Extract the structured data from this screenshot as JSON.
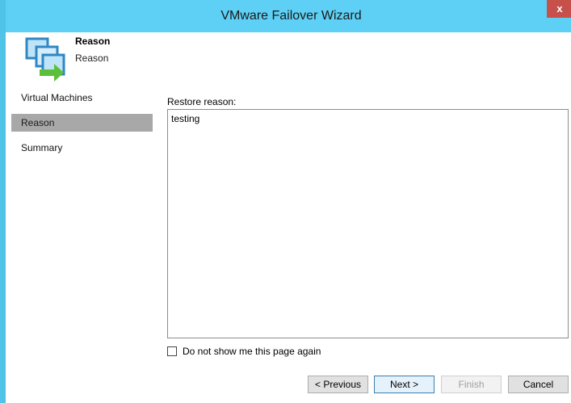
{
  "window": {
    "title": "VMware Failover Wizard",
    "close_label": "x"
  },
  "header": {
    "title": "Reason",
    "subtitle": "Reason",
    "icon": "vm-failover-icon"
  },
  "nav": {
    "items": [
      {
        "label": "Virtual Machines",
        "active": false
      },
      {
        "label": "Reason",
        "active": true
      },
      {
        "label": "Summary",
        "active": false
      }
    ]
  },
  "form": {
    "label": "Restore reason:",
    "value": "testing",
    "checkbox_label": "Do not show me this page again",
    "checkbox_checked": false
  },
  "buttons": {
    "previous": "< Previous",
    "next": "Next >",
    "finish": "Finish",
    "cancel": "Cancel"
  },
  "colors": {
    "titlebar": "#5ed0f5",
    "close": "#c7504b",
    "nav_active": "#a8a8a8"
  }
}
